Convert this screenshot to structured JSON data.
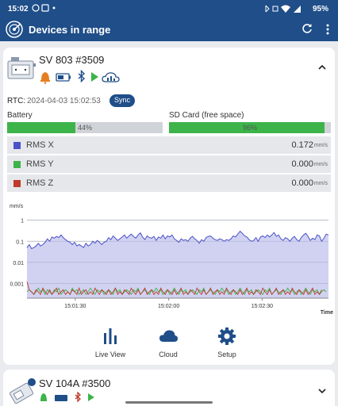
{
  "status_bar": {
    "time": "15:02",
    "battery": "95%"
  },
  "app_bar": {
    "title": "Devices in range"
  },
  "device1": {
    "name": "SV 803 #3509",
    "rtc_label": "RTC:",
    "rtc_value": "2024-04-03 15:02:53",
    "sync_label": "Sync",
    "battery_label": "Battery",
    "battery_value": "44%",
    "battery_fraction": 0.44,
    "sd_label": "SD Card (free space)",
    "sd_value": "96%",
    "sd_fraction": 0.96,
    "rms": [
      {
        "name": "RMS X",
        "value": "0.172",
        "unit": "mm/s",
        "color": "#4a52c9"
      },
      {
        "name": "RMS Y",
        "value": "0.000",
        "unit": "mm/s",
        "color": "#3cb44a"
      },
      {
        "name": "RMS Z",
        "value": "0.000",
        "unit": "mm/s",
        "color": "#c0392b"
      }
    ],
    "tabs": [
      {
        "label": "Live View"
      },
      {
        "label": "Cloud"
      },
      {
        "label": "Setup"
      }
    ]
  },
  "device2": {
    "name": "SV 104A #3500"
  },
  "chart_data": {
    "type": "line",
    "ylabel": "mm/s",
    "xlabel": "Time",
    "y_scale": "log",
    "yticks": [
      "1",
      "0.1",
      "0.01",
      "0.001"
    ],
    "ylim": [
      0.0002,
      1.5
    ],
    "xticks": [
      "15:01:30",
      "15:02:00",
      "15:02:30"
    ],
    "grid": true,
    "series": [
      {
        "color": "#4a52c9",
        "values": [
          0.05,
          0.07,
          0.045,
          0.05,
          0.06,
          0.08,
          0.06,
          0.07,
          0.09,
          0.13,
          0.1,
          0.16,
          0.14,
          0.17,
          0.15,
          0.2,
          0.15,
          0.12,
          0.1,
          0.09,
          0.07,
          0.09,
          0.06,
          0.07,
          0.06,
          0.05,
          0.08,
          0.06,
          0.07,
          0.1,
          0.08,
          0.11,
          0.09,
          0.07,
          0.09,
          0.1,
          0.15,
          0.12,
          0.18,
          0.14,
          0.11,
          0.13,
          0.16,
          0.2,
          0.14,
          0.18,
          0.22,
          0.17,
          0.14,
          0.2,
          0.25,
          0.16,
          0.12,
          0.18,
          0.15,
          0.14,
          0.17,
          0.11,
          0.16,
          0.14,
          0.2,
          0.13,
          0.18,
          0.16,
          0.2,
          0.13,
          0.11,
          0.09,
          0.13,
          0.11,
          0.12,
          0.1,
          0.14,
          0.17,
          0.13,
          0.11,
          0.08,
          0.12,
          0.1,
          0.15,
          0.17,
          0.18,
          0.14,
          0.12,
          0.11,
          0.13,
          0.12,
          0.1,
          0.12,
          0.11,
          0.13,
          0.18,
          0.16,
          0.22,
          0.3,
          0.24,
          0.18,
          0.16,
          0.12,
          0.1,
          0.11,
          0.15,
          0.1,
          0.16,
          0.18,
          0.15,
          0.2,
          0.16,
          0.2,
          0.26,
          0.17,
          0.2,
          0.13,
          0.11,
          0.15,
          0.13,
          0.1,
          0.14,
          0.17,
          0.12,
          0.1,
          0.15,
          0.2,
          0.24,
          0.17,
          0.11,
          0.14,
          0.12,
          0.2,
          0.18,
          0.1,
          0.14,
          0.22,
          0.2
        ]
      },
      {
        "color": "#3cb44a",
        "values": [
          0.0004,
          0.0005,
          0.0004,
          0.0003,
          0.0004,
          0.0006,
          0.0004,
          0.0005,
          0.0003,
          0.0005,
          0.0004,
          0.0003,
          0.0005,
          0.0004,
          0.0006,
          0.0003,
          0.0004,
          0.0005,
          0.0004,
          0.0003,
          0.0006,
          0.0004,
          0.0005,
          0.0003,
          0.0004,
          0.0005,
          0.0003,
          0.0004,
          0.0006,
          0.0004,
          0.0003,
          0.0005,
          0.0004,
          0.0005,
          0.0003,
          0.0004,
          0.0005,
          0.0004,
          0.0003,
          0.0006,
          0.0004,
          0.0005,
          0.0003,
          0.0004,
          0.0005,
          0.0004,
          0.0003,
          0.0005,
          0.0004,
          0.0006,
          0.0003,
          0.0004,
          0.0005,
          0.0004,
          0.0003,
          0.0005,
          0.0004,
          0.0006,
          0.0004,
          0.0005,
          0.0003,
          0.0004,
          0.0005,
          0.0003,
          0.0004,
          0.0006,
          0.0004,
          0.0003,
          0.0005,
          0.0004,
          0.0005,
          0.0003,
          0.0004,
          0.0005,
          0.0004,
          0.0003,
          0.0005,
          0.0004,
          0.0006,
          0.0003,
          0.0004,
          0.0005,
          0.0004,
          0.0003,
          0.0005,
          0.0004,
          0.0006,
          0.0004,
          0.0005,
          0.0003,
          0.0004,
          0.0005,
          0.0003,
          0.0004,
          0.0006,
          0.0004,
          0.0003,
          0.0005,
          0.0004,
          0.0005,
          0.0003,
          0.0004,
          0.0005,
          0.0004,
          0.0003,
          0.0005,
          0.0004,
          0.0006,
          0.0003,
          0.0004,
          0.0005,
          0.0004,
          0.0003,
          0.0005,
          0.0004,
          0.0006,
          0.0004,
          0.0005,
          0.0003,
          0.0004,
          0.0005,
          0.0003,
          0.0004,
          0.0006,
          0.0004,
          0.0003,
          0.0005,
          0.0004,
          0.0005,
          0.0003,
          0.0004,
          0.0005,
          0.0004
        ]
      },
      {
        "color": "#c0392b",
        "values": [
          0.0012,
          0.0005,
          0.0004,
          0.0003,
          0.0005,
          0.0004,
          0.0003,
          0.0006,
          0.0004,
          0.0003,
          0.0005,
          0.0003,
          0.0004,
          0.0006,
          0.0003,
          0.0004,
          0.0005,
          0.0003,
          0.0004,
          0.0003,
          0.0005,
          0.0004,
          0.0003,
          0.0006,
          0.0003,
          0.0004,
          0.0005,
          0.0003,
          0.0004,
          0.0003,
          0.0006,
          0.0004,
          0.0003,
          0.0005,
          0.0004,
          0.0003,
          0.0005,
          0.0003,
          0.0004,
          0.0006,
          0.0003,
          0.0004,
          0.0003,
          0.0005,
          0.0004,
          0.0003,
          0.0006,
          0.0004,
          0.0003,
          0.0005,
          0.0003,
          0.0004,
          0.0006,
          0.0003,
          0.0004,
          0.0005,
          0.0003,
          0.0004,
          0.0003,
          0.0006,
          0.0004,
          0.0003,
          0.0005,
          0.0004,
          0.0003,
          0.0005,
          0.0003,
          0.0004,
          0.0006,
          0.0003,
          0.0004,
          0.0003,
          0.0005,
          0.0004,
          0.0003,
          0.0006,
          0.0004,
          0.0003,
          0.0005,
          0.0003,
          0.0004,
          0.0006,
          0.0003,
          0.0004,
          0.0005,
          0.0003,
          0.0004,
          0.0003,
          0.0006,
          0.0004,
          0.0003,
          0.0005,
          0.0004,
          0.0003,
          0.0005,
          0.0003,
          0.0004,
          0.0006,
          0.0003,
          0.0004,
          0.0003,
          0.0005,
          0.0004,
          0.0003,
          0.0006,
          0.0004,
          0.0003,
          0.0005,
          0.0003,
          0.0004,
          0.0006,
          0.0003,
          0.0004,
          0.0005,
          0.0003,
          0.0004,
          0.0003,
          0.0006,
          0.0004,
          0.0003,
          0.0005,
          0.0004,
          0.0003,
          0.0005,
          0.0003,
          0.0004,
          0.0006,
          0.0003,
          0.0004,
          0.0003,
          0.0005
        ]
      }
    ]
  }
}
